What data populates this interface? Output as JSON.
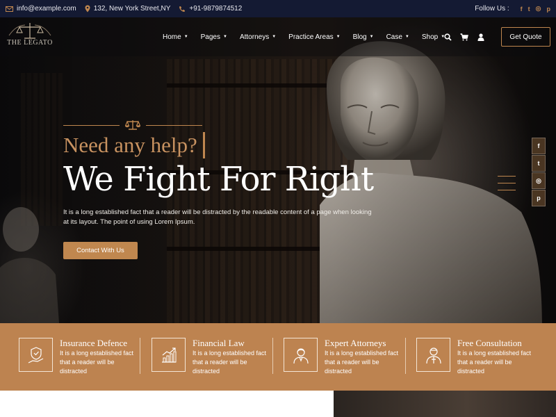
{
  "topbar": {
    "email": "info@example.com",
    "address": "132, New York Street,NY",
    "phone": "+91-9879874512",
    "follow_label": "Follow Us :",
    "socials": [
      "f",
      "t",
      "◎",
      "p"
    ]
  },
  "logo": {
    "text": "THE LEGATO"
  },
  "nav": {
    "items": [
      "Home",
      "Pages",
      "Attorneys",
      "Practice Areas",
      "Blog",
      "Case",
      "Shop"
    ],
    "icons": [
      "search-icon",
      "cart-icon",
      "user-icon"
    ],
    "cta_label": "Get Quote"
  },
  "hero": {
    "subtitle": "Need any help?",
    "headline": "We Fight For Right",
    "description": "It is a long established fact that a reader will be distracted by the readable content of a page when looking at its layout. The point of using Lorem Ipsum.",
    "button_label": "Contact With Us"
  },
  "side_social": [
    "f",
    "t",
    "◎",
    "p"
  ],
  "services": [
    {
      "title": "Insurance Defence",
      "text": "It is a long established fact that a reader will be distracted",
      "icon": "shield-hand-icon"
    },
    {
      "title": "Financial Law",
      "text": "It is a long established fact that a reader will be distracted",
      "icon": "chart-growth-icon"
    },
    {
      "title": "Expert Attorneys",
      "text": "It is a long established fact that a reader will be distracted",
      "icon": "attorney-icon"
    },
    {
      "title": "Free Consultation",
      "text": "It is a long established fact that a reader will be distracted",
      "icon": "consultant-icon"
    }
  ],
  "colors": {
    "accent": "#c0874f",
    "topbar": "#141a33",
    "band": "#bd8350"
  }
}
